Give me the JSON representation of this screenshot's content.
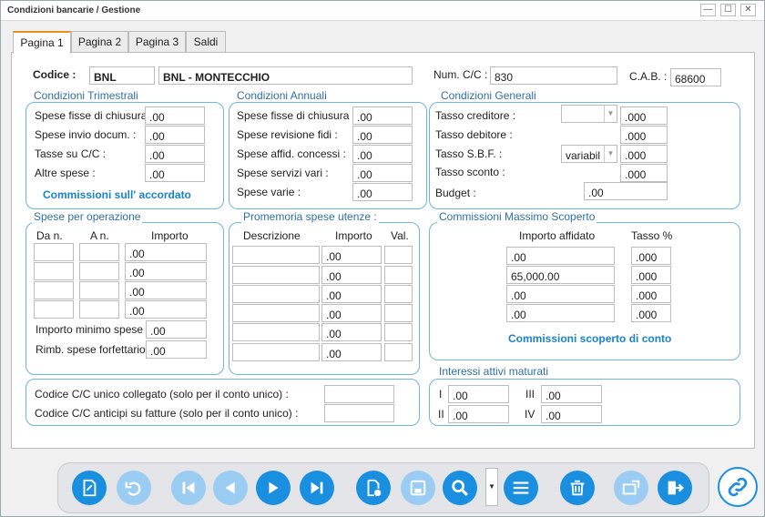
{
  "window": {
    "title": "Condizioni bancarie / Gestione",
    "min": "—",
    "max": "☐",
    "close": "✕"
  },
  "tabs": [
    "Pagina 1",
    "Pagina 2",
    "Pagina 3",
    "Saldi"
  ],
  "header": {
    "codice_label": "Codice :",
    "codice_value": "BNL",
    "codice_desc": "BNL - MONTECCHIO",
    "numcc_label": "Num. C/C :",
    "numcc_value": "830",
    "cab_label": "C.A.B. :",
    "cab_value": "68600"
  },
  "trimestrali": {
    "title": "Condizioni Trimestrali",
    "rows": [
      {
        "label": "Spese fisse di chiusura",
        "value": ".00"
      },
      {
        "label": "Spese invio docum.    :",
        "value": ".00"
      },
      {
        "label": "Tasse su C/C :",
        "value": ".00"
      },
      {
        "label": "Altre spese :",
        "value": ".00"
      }
    ],
    "link": "Commissioni sull' accordato"
  },
  "annuali": {
    "title": "Condizioni Annuali",
    "rows": [
      {
        "label": "Spese fisse di chiusura :",
        "value": ".00"
      },
      {
        "label": "Spese revisione fidi :",
        "value": ".00"
      },
      {
        "label": "Spese affid. concessi :",
        "value": ".00"
      },
      {
        "label": "Spese servizi vari :",
        "value": ".00"
      },
      {
        "label": "Spese varie :",
        "value": ".00"
      }
    ]
  },
  "generali": {
    "title": "Condizioni Generali",
    "tasso_creditore": {
      "label": "Tasso creditore :",
      "value": ".000"
    },
    "tasso_debitore": {
      "label": "Tasso debitore :",
      "value": ".000"
    },
    "tasso_sbf": {
      "label": "Tasso S.B.F. :",
      "select": "variabil",
      "value": ".000"
    },
    "tasso_sconto": {
      "label": "Tasso sconto :",
      "value": ".000"
    },
    "budget": {
      "label": "Budget :",
      "value": ".00"
    }
  },
  "operazione": {
    "title": "Spese per operazione",
    "col_da": "Da n.",
    "col_a": "A n.",
    "col_importo": "Importo",
    "values": [
      ".00",
      ".00",
      ".00",
      ".00"
    ],
    "minimo_label": "Importo minimo spese",
    "minimo_value": ".00",
    "rimb_label": "Rimb. spese forfettario",
    "rimb_value": ".00"
  },
  "promemoria": {
    "title": "Promemoria spese utenze :",
    "col_desc": "Descrizione",
    "col_importo": "Importo",
    "col_val": "Val.",
    "values": [
      ".00",
      ".00",
      ".00",
      ".00",
      ".00",
      ".00"
    ]
  },
  "scoperto": {
    "title": "Commissioni Massimo Scoperto",
    "col_importo": "Importo affidato",
    "col_tasso": "Tasso %",
    "rows": [
      {
        "importo": ".00",
        "tasso": ".000"
      },
      {
        "importo": "65,000.00",
        "tasso": ".000"
      },
      {
        "importo": ".00",
        "tasso": ".000"
      },
      {
        "importo": ".00",
        "tasso": ".000"
      }
    ],
    "link": "Commissioni scoperto di conto"
  },
  "collegato": {
    "unico_label": "Codice C/C unico collegato (solo per il conto unico) :",
    "anticipi_label": "Codice C/C anticipi su fatture (solo per il conto unico) :"
  },
  "interessi": {
    "title": "Interessi attivi maturati",
    "rows": [
      {
        "label": "I",
        "value": ".00"
      },
      {
        "label": "III",
        "value": ".00"
      },
      {
        "label": "II",
        "value": ".00"
      },
      {
        "label": "IV",
        "value": ".00"
      }
    ]
  },
  "toolbar": {
    "buttons": [
      "new-document-icon",
      "undo-icon",
      "first-record-icon",
      "previous-record-icon",
      "next-record-icon",
      "last-record-icon",
      "add-document-icon",
      "save-icon",
      "search-icon",
      "list-icon",
      "delete-icon",
      "export-icon",
      "exit-icon",
      "link-icon"
    ],
    "accent": "#1a8fe0"
  }
}
